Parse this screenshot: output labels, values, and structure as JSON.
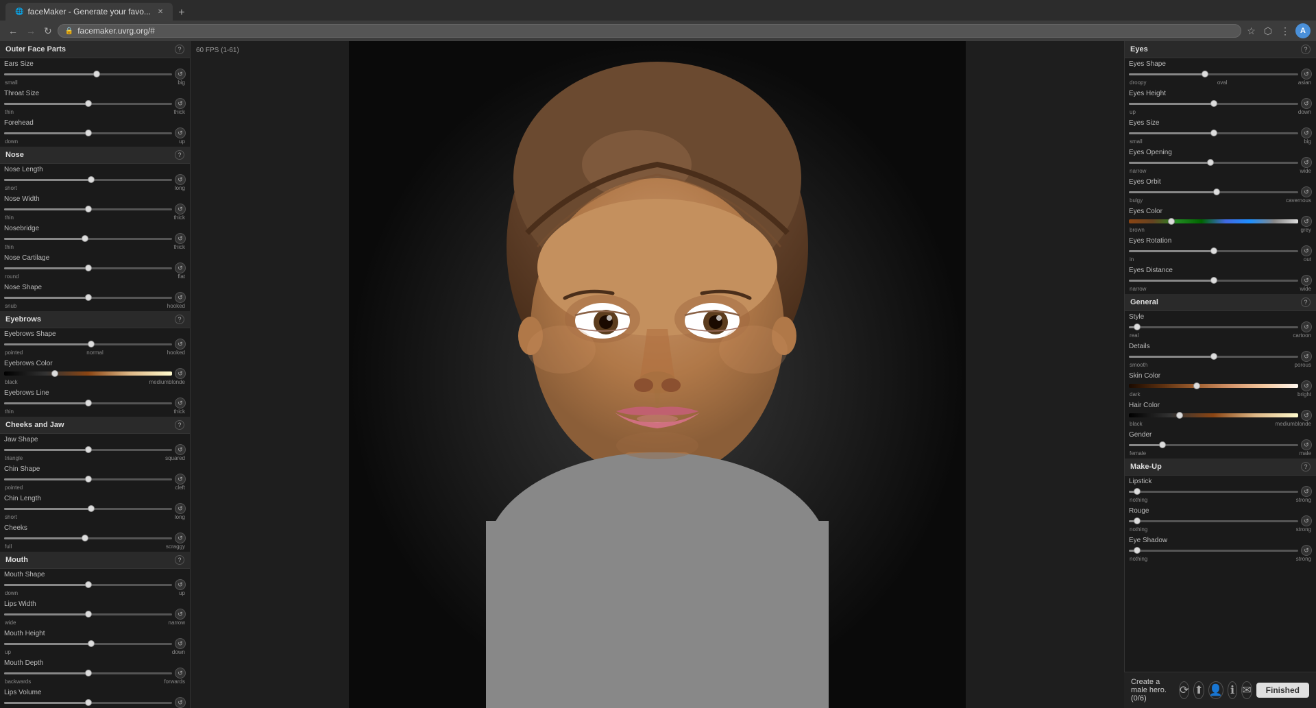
{
  "browser": {
    "tab_title": "faceMaker - Generate your favo...",
    "url": "facemaker.uvrg.org/#",
    "new_tab_label": "+",
    "user_avatar": "A"
  },
  "fps_label": "60 FPS (1-61)",
  "left_panel": {
    "title": "Outer Face Parts",
    "sections": [
      {
        "name": "Outer Face Parts",
        "controls": [
          {
            "label": "Ears Size",
            "min_label": "small",
            "max_label": "big",
            "value": 55
          },
          {
            "label": "Throat Size",
            "min_label": "thin",
            "max_label": "thick",
            "value": 50
          },
          {
            "label": "Forehead",
            "min_label": "down",
            "max_label": "up",
            "value": 50
          }
        ]
      },
      {
        "name": "Nose",
        "controls": [
          {
            "label": "Nose Length",
            "min_label": "short",
            "max_label": "long",
            "value": 52
          },
          {
            "label": "Nose Width",
            "min_label": "thin",
            "max_label": "thick",
            "value": 50
          },
          {
            "label": "Nosebridge",
            "min_label": "thin",
            "max_label": "thick",
            "value": 48
          },
          {
            "label": "Nose Cartilage",
            "min_label": "round",
            "max_label": "flat",
            "value": 50
          },
          {
            "label": "Nose Shape",
            "min_label": "snub",
            "max_label": "hooked",
            "value": 50
          }
        ]
      },
      {
        "name": "Eyebrows",
        "controls": [
          {
            "label": "Eyebrows Shape",
            "min_label": "pointed",
            "mid_label": "normal",
            "max_label": "hooked",
            "value": 52
          },
          {
            "label": "Eyebrows Color",
            "min_label": "black",
            "max_label": "mediumblonde",
            "value": 30,
            "type": "color",
            "color_type": "eyebrows"
          },
          {
            "label": "Eyebrows Line",
            "min_label": "thin",
            "max_label": "thick",
            "value": 50
          }
        ]
      },
      {
        "name": "Cheeks and Jaw",
        "controls": [
          {
            "label": "Jaw Shape",
            "min_label": "triangle",
            "max_label": "squared",
            "value": 50
          },
          {
            "label": "Chin Shape",
            "min_label": "pointed",
            "max_label": "cleft",
            "value": 50
          },
          {
            "label": "Chin Length",
            "min_label": "short",
            "max_label": "long",
            "value": 52
          },
          {
            "label": "Cheeks",
            "min_label": "full",
            "max_label": "scraggy",
            "value": 48
          }
        ]
      },
      {
        "name": "Mouth",
        "controls": [
          {
            "label": "Mouth Shape",
            "min_label": "down",
            "max_label": "up",
            "value": 50
          },
          {
            "label": "Lips Width",
            "min_label": "wide",
            "max_label": "narrow",
            "value": 50
          },
          {
            "label": "Mouth Height",
            "min_label": "up",
            "max_label": "down",
            "value": 52
          },
          {
            "label": "Mouth Depth",
            "min_label": "backwards",
            "max_label": "forwards",
            "value": 50
          },
          {
            "label": "Lips Volume",
            "min_label": "",
            "max_label": "",
            "value": 50
          }
        ]
      }
    ]
  },
  "right_panel": {
    "eyes_title": "Eyes",
    "general_title": "General",
    "makeup_title": "Make-Up",
    "eyes_controls": [
      {
        "label": "Eyes Shape",
        "min_label": "droopy",
        "mid_label": "oval",
        "max_label": "asian",
        "value": 45
      },
      {
        "label": "Eyes Height",
        "min_label": "up",
        "max_label": "down",
        "value": 50
      },
      {
        "label": "Eyes Size",
        "min_label": "small",
        "max_label": "big",
        "value": 50
      },
      {
        "label": "Eyes Opening",
        "min_label": "narrow",
        "max_label": "wide",
        "value": 48
      },
      {
        "label": "Eyes Orbit",
        "min_label": "bulgy",
        "max_label": "cavernous",
        "value": 52
      },
      {
        "label": "Eyes Color",
        "min_label": "brown",
        "max_label": "grey",
        "value": 25,
        "type": "color",
        "color_type": "eyes"
      },
      {
        "label": "Eyes Rotation",
        "min_label": "in",
        "max_label": "out",
        "value": 50
      },
      {
        "label": "Eyes Distance",
        "min_label": "narrow",
        "max_label": "wide",
        "value": 50
      }
    ],
    "general_controls": [
      {
        "label": "Style",
        "min_label": "real",
        "max_label": "cartoon",
        "value": 5
      },
      {
        "label": "Details",
        "min_label": "smooth",
        "max_label": "porous",
        "value": 50
      },
      {
        "label": "Skin Color",
        "min_label": "dark",
        "max_label": "bright",
        "value": 40,
        "type": "color",
        "color_type": "skin"
      },
      {
        "label": "Hair Color",
        "min_label": "black",
        "max_label": "mediumblonde",
        "value": 30,
        "type": "color",
        "color_type": "hair"
      },
      {
        "label": "Gender",
        "min_label": "female",
        "max_label": "male",
        "value": 20
      }
    ],
    "makeup_controls": [
      {
        "label": "Lipstick",
        "min_label": "nothing",
        "max_label": "strong",
        "value": 5
      },
      {
        "label": "Rouge",
        "min_label": "nothing",
        "max_label": "strong",
        "value": 5
      },
      {
        "label": "Eye Shadow",
        "min_label": "nothing",
        "max_label": "strong",
        "value": 5
      }
    ]
  },
  "bottom": {
    "text": "Create a male hero. (0/6)",
    "finished_label": "Finished"
  },
  "icons": {
    "refresh": "↺",
    "back": "←",
    "forward": "→",
    "lock": "🔒",
    "star": "☆",
    "extensions": "⬡",
    "menu": "⋮",
    "help": "?",
    "reset": "↺",
    "random": "⟳",
    "share": "⬆",
    "profile": "👤",
    "info": "ℹ",
    "mail": "✉"
  }
}
